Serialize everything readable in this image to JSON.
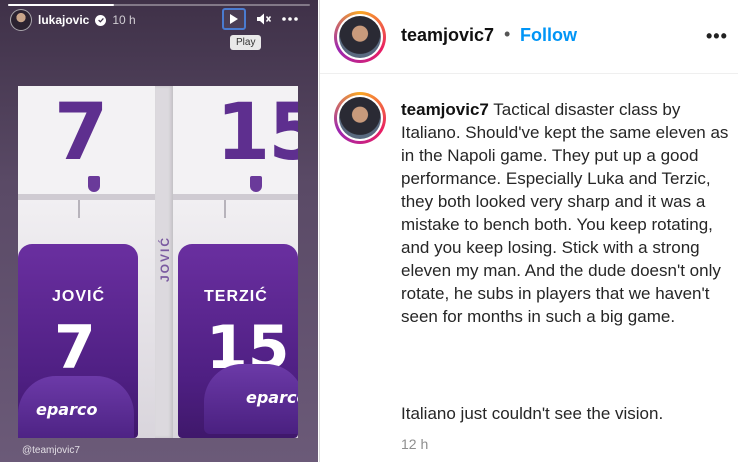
{
  "story": {
    "username": "lukajovic",
    "time": "10 h",
    "progress": 0.35,
    "play_tooltip": "Play",
    "tag": "@teamjovic7",
    "icons": {
      "verified": "verified-badge-icon",
      "play": "play-icon",
      "mute": "muted-speaker-icon",
      "more": "more-horizontal-icon"
    },
    "image": {
      "locker_numbers": [
        "7",
        "15"
      ],
      "vertical_name": "JOVIĆ",
      "shirts": [
        {
          "name": "JOVIĆ",
          "number": "7"
        },
        {
          "name": "TERZIĆ",
          "number": "15"
        }
      ],
      "seat_logo": "eparco"
    }
  },
  "post": {
    "username": "teamjovic7",
    "separator": "•",
    "follow_label": "Follow",
    "more_label": "•••",
    "caption_user": "teamjovic7",
    "caption_text": " Tactical disaster class by Italiano. Should've kept the same eleven as in the Napoli game. They put up a good performance. Especially Luka and Terzic, they both looked very sharp and it was a mistake to bench both. You keep rotating, and you keep losing. Stick with a strong eleven my man. And the dude doesn't only rotate, he subs in players that we haven't seen for months in such a big game.",
    "caption_line2": "Italiano just couldn't see the vision.",
    "time": "12 h"
  },
  "colors": {
    "follow": "#0095f6",
    "jersey": "#5a2a92",
    "play_focus": "#4a7bd0"
  }
}
